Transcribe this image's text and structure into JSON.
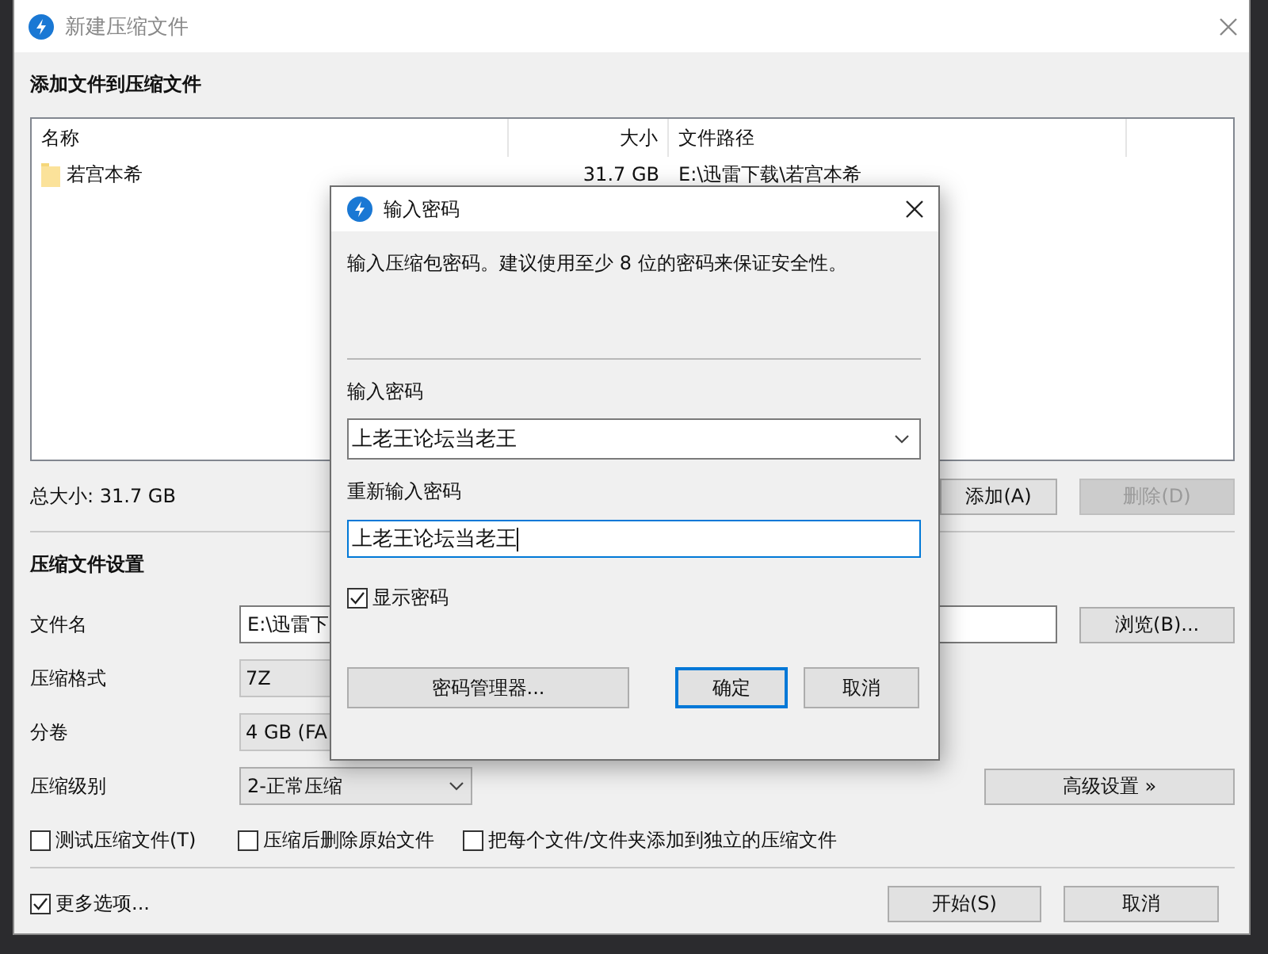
{
  "main_window": {
    "title": "新建压缩文件"
  },
  "files_section": {
    "heading": "添加文件到压缩文件",
    "columns": [
      "名称",
      "大小",
      "文件路径"
    ],
    "rows": [
      {
        "name": "若宫本希",
        "size": "31.7 GB",
        "path": "E:\\迅雷下载\\若宫本希"
      }
    ],
    "total": "总大小: 31.7 GB",
    "buttons": [
      {
        "label": "添加(A)",
        "disabled": false
      },
      {
        "label": "删除(D)",
        "disabled": true
      }
    ]
  },
  "settings": {
    "heading": "压缩文件设置",
    "fields": [
      {
        "label": "文件名",
        "kind": "text",
        "value": "E:\\迅雷下",
        "button": "浏览(B)..."
      },
      {
        "label": "压缩格式",
        "kind": "combo",
        "value": "7Z"
      },
      {
        "label": "分卷",
        "kind": "combo",
        "value": "4 GB (FA"
      },
      {
        "label": "压缩级别",
        "kind": "dropdown",
        "value": "2-正常压缩",
        "button": "高级设置 »"
      }
    ],
    "options": [
      {
        "label": "测试压缩文件(T)",
        "checked": false
      },
      {
        "label": "压缩后删除原始文件",
        "checked": false
      },
      {
        "label": "把每个文件/文件夹添加到独立的压缩文件",
        "checked": false
      }
    ]
  },
  "footer": {
    "more_options": {
      "label": "更多选项...",
      "checked": true
    },
    "buttons": [
      "开始(S)",
      "取消"
    ]
  },
  "dialog": {
    "title": "输入密码",
    "message": "输入压缩包密码。建议使用至少 8 位的密码来保证安全性。",
    "password_label": "输入密码",
    "password": "上老王论坛当老王",
    "confirm_label": "重新输入密码",
    "confirm": "上老王论坛当老王",
    "show_password": {
      "label": "显示密码",
      "checked": true
    },
    "buttons": [
      {
        "label": "密码管理器...",
        "default": false
      },
      {
        "label": "确定",
        "default": true
      },
      {
        "label": "取消",
        "default": false
      }
    ]
  }
}
